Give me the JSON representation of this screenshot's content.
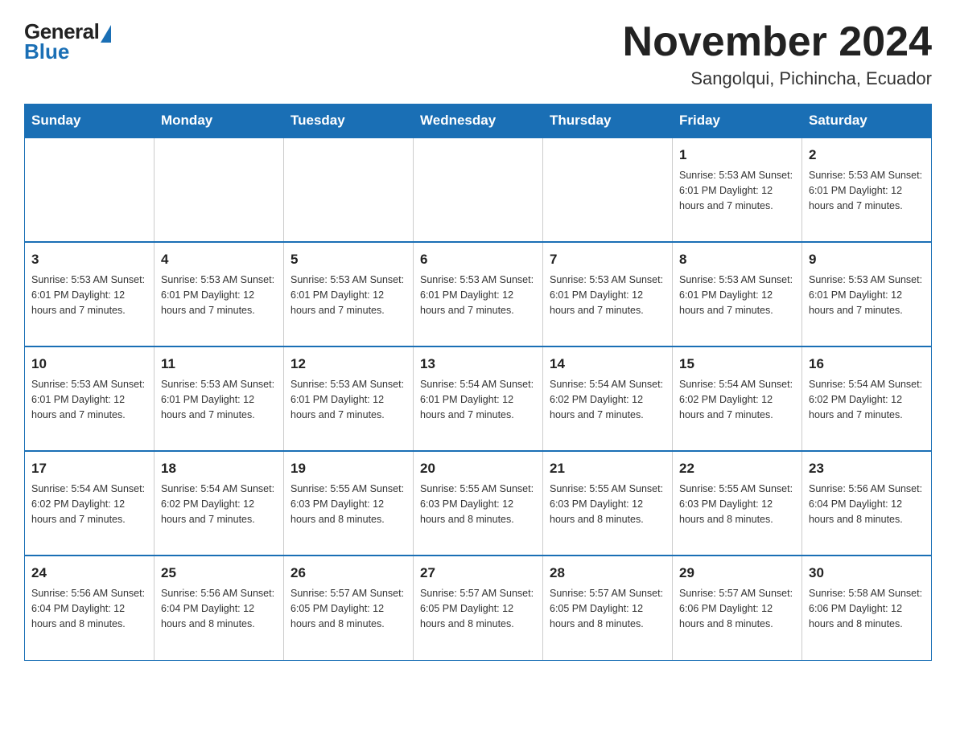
{
  "header": {
    "logo": {
      "general": "General",
      "blue": "Blue"
    },
    "title": "November 2024",
    "subtitle": "Sangolqui, Pichincha, Ecuador"
  },
  "weekdays": [
    "Sunday",
    "Monday",
    "Tuesday",
    "Wednesday",
    "Thursday",
    "Friday",
    "Saturday"
  ],
  "weeks": [
    [
      {
        "day": "",
        "info": ""
      },
      {
        "day": "",
        "info": ""
      },
      {
        "day": "",
        "info": ""
      },
      {
        "day": "",
        "info": ""
      },
      {
        "day": "",
        "info": ""
      },
      {
        "day": "1",
        "info": "Sunrise: 5:53 AM\nSunset: 6:01 PM\nDaylight: 12 hours\nand 7 minutes."
      },
      {
        "day": "2",
        "info": "Sunrise: 5:53 AM\nSunset: 6:01 PM\nDaylight: 12 hours\nand 7 minutes."
      }
    ],
    [
      {
        "day": "3",
        "info": "Sunrise: 5:53 AM\nSunset: 6:01 PM\nDaylight: 12 hours\nand 7 minutes."
      },
      {
        "day": "4",
        "info": "Sunrise: 5:53 AM\nSunset: 6:01 PM\nDaylight: 12 hours\nand 7 minutes."
      },
      {
        "day": "5",
        "info": "Sunrise: 5:53 AM\nSunset: 6:01 PM\nDaylight: 12 hours\nand 7 minutes."
      },
      {
        "day": "6",
        "info": "Sunrise: 5:53 AM\nSunset: 6:01 PM\nDaylight: 12 hours\nand 7 minutes."
      },
      {
        "day": "7",
        "info": "Sunrise: 5:53 AM\nSunset: 6:01 PM\nDaylight: 12 hours\nand 7 minutes."
      },
      {
        "day": "8",
        "info": "Sunrise: 5:53 AM\nSunset: 6:01 PM\nDaylight: 12 hours\nand 7 minutes."
      },
      {
        "day": "9",
        "info": "Sunrise: 5:53 AM\nSunset: 6:01 PM\nDaylight: 12 hours\nand 7 minutes."
      }
    ],
    [
      {
        "day": "10",
        "info": "Sunrise: 5:53 AM\nSunset: 6:01 PM\nDaylight: 12 hours\nand 7 minutes."
      },
      {
        "day": "11",
        "info": "Sunrise: 5:53 AM\nSunset: 6:01 PM\nDaylight: 12 hours\nand 7 minutes."
      },
      {
        "day": "12",
        "info": "Sunrise: 5:53 AM\nSunset: 6:01 PM\nDaylight: 12 hours\nand 7 minutes."
      },
      {
        "day": "13",
        "info": "Sunrise: 5:54 AM\nSunset: 6:01 PM\nDaylight: 12 hours\nand 7 minutes."
      },
      {
        "day": "14",
        "info": "Sunrise: 5:54 AM\nSunset: 6:02 PM\nDaylight: 12 hours\nand 7 minutes."
      },
      {
        "day": "15",
        "info": "Sunrise: 5:54 AM\nSunset: 6:02 PM\nDaylight: 12 hours\nand 7 minutes."
      },
      {
        "day": "16",
        "info": "Sunrise: 5:54 AM\nSunset: 6:02 PM\nDaylight: 12 hours\nand 7 minutes."
      }
    ],
    [
      {
        "day": "17",
        "info": "Sunrise: 5:54 AM\nSunset: 6:02 PM\nDaylight: 12 hours\nand 7 minutes."
      },
      {
        "day": "18",
        "info": "Sunrise: 5:54 AM\nSunset: 6:02 PM\nDaylight: 12 hours\nand 7 minutes."
      },
      {
        "day": "19",
        "info": "Sunrise: 5:55 AM\nSunset: 6:03 PM\nDaylight: 12 hours\nand 8 minutes."
      },
      {
        "day": "20",
        "info": "Sunrise: 5:55 AM\nSunset: 6:03 PM\nDaylight: 12 hours\nand 8 minutes."
      },
      {
        "day": "21",
        "info": "Sunrise: 5:55 AM\nSunset: 6:03 PM\nDaylight: 12 hours\nand 8 minutes."
      },
      {
        "day": "22",
        "info": "Sunrise: 5:55 AM\nSunset: 6:03 PM\nDaylight: 12 hours\nand 8 minutes."
      },
      {
        "day": "23",
        "info": "Sunrise: 5:56 AM\nSunset: 6:04 PM\nDaylight: 12 hours\nand 8 minutes."
      }
    ],
    [
      {
        "day": "24",
        "info": "Sunrise: 5:56 AM\nSunset: 6:04 PM\nDaylight: 12 hours\nand 8 minutes."
      },
      {
        "day": "25",
        "info": "Sunrise: 5:56 AM\nSunset: 6:04 PM\nDaylight: 12 hours\nand 8 minutes."
      },
      {
        "day": "26",
        "info": "Sunrise: 5:57 AM\nSunset: 6:05 PM\nDaylight: 12 hours\nand 8 minutes."
      },
      {
        "day": "27",
        "info": "Sunrise: 5:57 AM\nSunset: 6:05 PM\nDaylight: 12 hours\nand 8 minutes."
      },
      {
        "day": "28",
        "info": "Sunrise: 5:57 AM\nSunset: 6:05 PM\nDaylight: 12 hours\nand 8 minutes."
      },
      {
        "day": "29",
        "info": "Sunrise: 5:57 AM\nSunset: 6:06 PM\nDaylight: 12 hours\nand 8 minutes."
      },
      {
        "day": "30",
        "info": "Sunrise: 5:58 AM\nSunset: 6:06 PM\nDaylight: 12 hours\nand 8 minutes."
      }
    ]
  ]
}
